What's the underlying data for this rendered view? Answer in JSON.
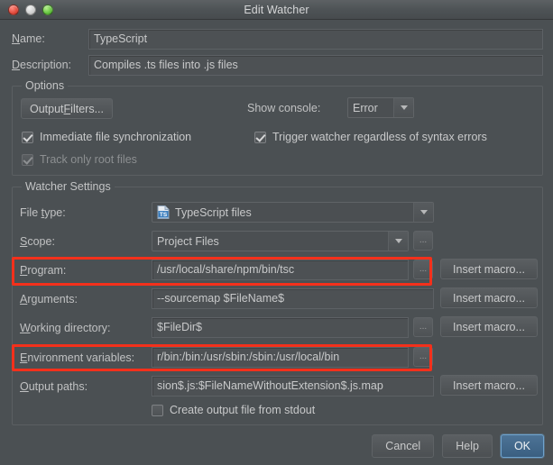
{
  "window": {
    "title": "Edit Watcher",
    "traffic_lights": [
      "close-red",
      "minimize-gray",
      "zoom-green"
    ]
  },
  "top_fields": {
    "name_label": "Name:",
    "name_value": "TypeScript",
    "description_label": "Description:",
    "description_value": "Compiles .ts files into .js files"
  },
  "options": {
    "legend": "Options",
    "output_filters_button": "Output Filters...",
    "show_console_label": "Show console:",
    "show_console_value": "Error",
    "show_console_options": [
      "Error"
    ],
    "checkboxes": [
      {
        "label": "Immediate file synchronization",
        "checked": true,
        "disabled": false
      },
      {
        "label": "Trigger watcher regardless of syntax errors",
        "checked": true,
        "disabled": false
      },
      {
        "label": "Track only root files",
        "checked": true,
        "disabled": true
      }
    ]
  },
  "watcher_settings": {
    "legend": "Watcher Settings",
    "file_type": {
      "label": "File type:",
      "value": "TypeScript files",
      "icon": "typescript-file-icon"
    },
    "scope": {
      "label": "Scope:",
      "value": "Project Files"
    },
    "program": {
      "label": "Program:",
      "value": "/usr/local/share/npm/bin/tsc",
      "macro_button": "Insert macro...",
      "highlighted": true
    },
    "arguments": {
      "label": "Arguments:",
      "value": "--sourcemap $FileName$",
      "macro_button": "Insert macro..."
    },
    "working_directory": {
      "label": "Working directory:",
      "value": "$FileDir$",
      "macro_button": "Insert macro..."
    },
    "environment_variables": {
      "label": "Environment variables:",
      "value": "r/bin:/bin:/usr/sbin:/sbin:/usr/local/bin",
      "highlighted": true
    },
    "output_paths": {
      "label": "Output paths:",
      "value": "sion$.js:$FileNameWithoutExtension$.js.map",
      "macro_button": "Insert macro..."
    },
    "create_output_checkbox": {
      "label": "Create output file from stdout",
      "checked": false
    },
    "ellipsis_label": "..."
  },
  "footer": {
    "cancel": "Cancel",
    "help": "Help",
    "ok": "OK"
  },
  "colors": {
    "highlight": "#f4301b",
    "dialog_bg": "#4b5053",
    "accent_button": "#4d7396"
  }
}
